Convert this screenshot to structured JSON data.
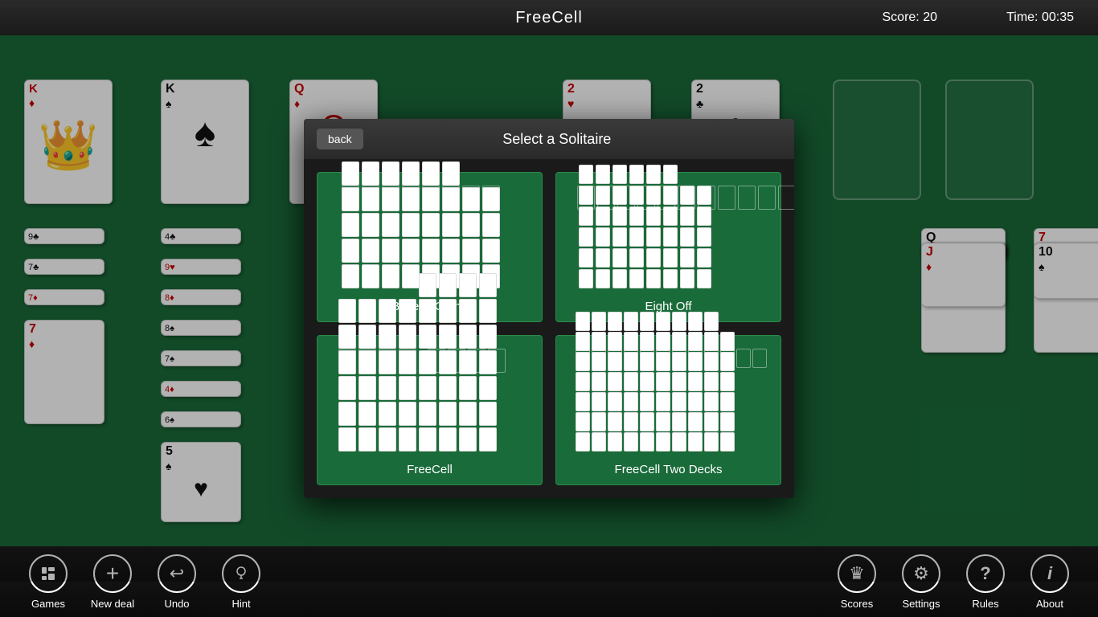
{
  "header": {
    "title": "FreeCell",
    "score_label": "Score:",
    "score_value": "20",
    "time_label": "Time:",
    "time_value": "00:35"
  },
  "modal": {
    "back_label": "back",
    "title": "Select a Solitaire",
    "games": [
      {
        "id": "bakers-game",
        "label": "Baker's Game"
      },
      {
        "id": "eight-off",
        "label": "Eight Off"
      },
      {
        "id": "freecell",
        "label": "FreeCell"
      },
      {
        "id": "freecell-two-decks",
        "label": "FreeCell Two Decks"
      }
    ]
  },
  "toolbar": {
    "left": [
      {
        "id": "games",
        "label": "Games",
        "icon": "♠"
      },
      {
        "id": "new-deal",
        "label": "New deal",
        "icon": "+"
      },
      {
        "id": "undo",
        "label": "Undo",
        "icon": "↩"
      },
      {
        "id": "hint",
        "label": "Hint",
        "icon": "💡"
      }
    ],
    "right": [
      {
        "id": "scores",
        "label": "Scores",
        "icon": "♛"
      },
      {
        "id": "settings",
        "label": "Settings",
        "icon": "⚙"
      },
      {
        "id": "rules",
        "label": "Rules",
        "icon": "?"
      },
      {
        "id": "about",
        "label": "About",
        "icon": "i"
      }
    ]
  }
}
